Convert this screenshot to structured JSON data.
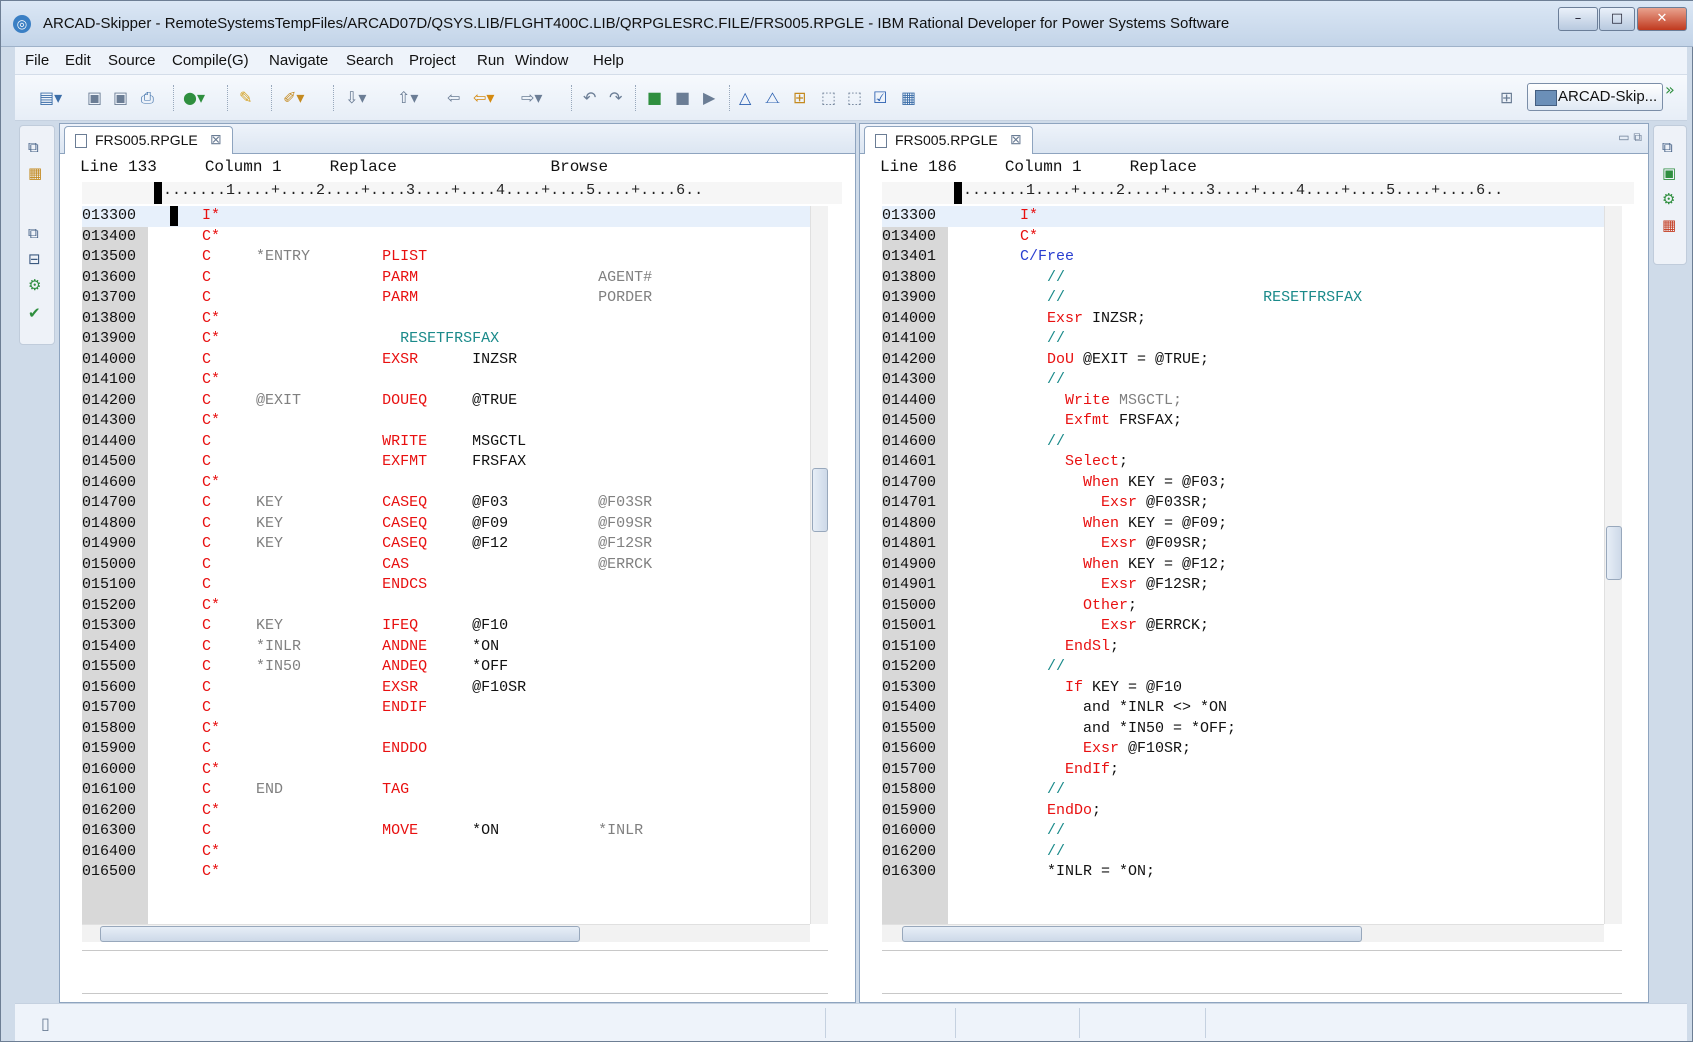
{
  "window": {
    "title": "ARCAD-Skipper - RemoteSystemsTempFiles/ARCAD07D/QSYS.LIB/FLGHT400C.LIB/QRPGLESRC.FILE/FRS005.RPGLE - IBM Rational Developer for Power Systems Software",
    "minimize": "–",
    "maximize": "□",
    "close": "✕"
  },
  "menu": [
    "File",
    "Edit",
    "Source",
    "Compile(G)",
    "Navigate",
    "Search",
    "Project",
    "Run",
    "Window",
    "Help"
  ],
  "perspective": {
    "label": "ARCAD-Skip...",
    "more": "»"
  },
  "left_editor": {
    "tab": "FRS005.RPGLE",
    "status": {
      "line": "Line 133",
      "column": "Column 1",
      "mode": "Replace",
      "browse": "Browse"
    },
    "ruler": "........1....+....2....+....3....+....4....+....5....+....6..",
    "lines": [
      {
        "seq": "013300",
        "spec": "I*",
        "c1": "",
        "op": "",
        "f2": "",
        "res": "",
        "cur": true
      },
      {
        "seq": "013400",
        "spec": "C*",
        "c1": "",
        "op": "",
        "f2": "",
        "res": ""
      },
      {
        "seq": "013500",
        "spec": "C",
        "c1": "*ENTRY",
        "op": "PLIST",
        "f2": "",
        "res": ""
      },
      {
        "seq": "013600",
        "spec": "C",
        "c1": "",
        "op": "PARM",
        "f2": "",
        "res": "AGENT#"
      },
      {
        "seq": "013700",
        "spec": "C",
        "c1": "",
        "op": "PARM",
        "f2": "",
        "res": "PORDER"
      },
      {
        "seq": "013800",
        "spec": "C*",
        "c1": "",
        "op": "",
        "f2": "",
        "res": ""
      },
      {
        "seq": "013900",
        "spec": "C*",
        "c1": "",
        "op": "",
        "f2": "",
        "res": "",
        "comment": "RESETFRSFAX"
      },
      {
        "seq": "014000",
        "spec": "C",
        "c1": "",
        "op": "EXSR",
        "f2": "INZSR",
        "res": ""
      },
      {
        "seq": "014100",
        "spec": "C*",
        "c1": "",
        "op": "",
        "f2": "",
        "res": ""
      },
      {
        "seq": "014200",
        "spec": "C",
        "c1": "@EXIT",
        "op": "DOUEQ",
        "f2": "@TRUE",
        "res": ""
      },
      {
        "seq": "014300",
        "spec": "C*",
        "c1": "",
        "op": "",
        "f2": "",
        "res": ""
      },
      {
        "seq": "014400",
        "spec": "C",
        "c1": "",
        "op": "WRITE",
        "f2": "MSGCTL",
        "res": ""
      },
      {
        "seq": "014500",
        "spec": "C",
        "c1": "",
        "op": "EXFMT",
        "f2": "FRSFAX",
        "res": ""
      },
      {
        "seq": "014600",
        "spec": "C*",
        "c1": "",
        "op": "",
        "f2": "",
        "res": ""
      },
      {
        "seq": "014700",
        "spec": "C",
        "c1": "KEY",
        "op": "CASEQ",
        "f2": "@F03",
        "res": "@F03SR"
      },
      {
        "seq": "014800",
        "spec": "C",
        "c1": "KEY",
        "op": "CASEQ",
        "f2": "@F09",
        "res": "@F09SR"
      },
      {
        "seq": "014900",
        "spec": "C",
        "c1": "KEY",
        "op": "CASEQ",
        "f2": "@F12",
        "res": "@F12SR"
      },
      {
        "seq": "015000",
        "spec": "C",
        "c1": "",
        "op": "CAS",
        "f2": "",
        "res": "@ERRCK"
      },
      {
        "seq": "015100",
        "spec": "C",
        "c1": "",
        "op": "ENDCS",
        "f2": "",
        "res": ""
      },
      {
        "seq": "015200",
        "spec": "C*",
        "c1": "",
        "op": "",
        "f2": "",
        "res": ""
      },
      {
        "seq": "015300",
        "spec": "C",
        "c1": "KEY",
        "op": "IFEQ",
        "f2": "@F10",
        "res": ""
      },
      {
        "seq": "015400",
        "spec": "C",
        "c1": "*INLR",
        "op": "ANDNE",
        "f2": "*ON",
        "res": ""
      },
      {
        "seq": "015500",
        "spec": "C",
        "c1": "*IN50",
        "op": "ANDEQ",
        "f2": "*OFF",
        "res": ""
      },
      {
        "seq": "015600",
        "spec": "C",
        "c1": "",
        "op": "EXSR",
        "f2": "@F10SR",
        "res": ""
      },
      {
        "seq": "015700",
        "spec": "C",
        "c1": "",
        "op": "ENDIF",
        "f2": "",
        "res": ""
      },
      {
        "seq": "015800",
        "spec": "C*",
        "c1": "",
        "op": "",
        "f2": "",
        "res": ""
      },
      {
        "seq": "015900",
        "spec": "C",
        "c1": "",
        "op": "ENDDO",
        "f2": "",
        "res": ""
      },
      {
        "seq": "016000",
        "spec": "C*",
        "c1": "",
        "op": "",
        "f2": "",
        "res": ""
      },
      {
        "seq": "016100",
        "spec": "C",
        "c1": "END",
        "op": "TAG",
        "f2": "",
        "res": ""
      },
      {
        "seq": "016200",
        "spec": "C*",
        "c1": "",
        "op": "",
        "f2": "",
        "res": ""
      },
      {
        "seq": "016300",
        "spec": "C",
        "c1": "",
        "op": "MOVE",
        "f2": "*ON",
        "res": "*INLR"
      },
      {
        "seq": "016400",
        "spec": "C*",
        "c1": "",
        "op": "",
        "f2": "",
        "res": ""
      },
      {
        "seq": "016500",
        "spec": "C*",
        "c1": "",
        "op": "",
        "f2": "",
        "res": ""
      }
    ]
  },
  "right_editor": {
    "tab": "FRS005.RPGLE",
    "status": {
      "line": "Line 186",
      "column": "Column 1",
      "mode": "Replace"
    },
    "ruler": "........1....+....2....+....3....+....4....+....5....+....6..",
    "lines": [
      {
        "seq": "013300",
        "parts": [
          {
            "t": "I*",
            "c": "red"
          }
        ],
        "cur": true
      },
      {
        "seq": "013400",
        "parts": [
          {
            "t": "C*",
            "c": "red"
          }
        ]
      },
      {
        "seq": "013401",
        "parts": [
          {
            "t": "C/Free",
            "c": "blue"
          }
        ]
      },
      {
        "seq": "013800",
        "parts": [
          {
            "t": "   //",
            "c": "teal"
          }
        ]
      },
      {
        "seq": "013900",
        "parts": [
          {
            "t": "   //",
            "c": "teal"
          },
          {
            "t": "                      RESETFRSFAX",
            "c": "teal"
          }
        ]
      },
      {
        "seq": "014000",
        "parts": [
          {
            "t": "   Exsr",
            "c": "red"
          },
          {
            "t": " INZSR;",
            "c": "black"
          }
        ]
      },
      {
        "seq": "014100",
        "parts": [
          {
            "t": "   //",
            "c": "teal"
          }
        ]
      },
      {
        "seq": "014200",
        "parts": [
          {
            "t": "   DoU",
            "c": "red"
          },
          {
            "t": " @EXIT = @TRUE;",
            "c": "black"
          }
        ]
      },
      {
        "seq": "014300",
        "parts": [
          {
            "t": "   //",
            "c": "teal"
          }
        ]
      },
      {
        "seq": "014400",
        "parts": [
          {
            "t": "     Write",
            "c": "red"
          },
          {
            "t": " MSGCTL;",
            "c": "gray"
          }
        ]
      },
      {
        "seq": "014500",
        "parts": [
          {
            "t": "     Exfmt",
            "c": "red"
          },
          {
            "t": " FRSFAX;",
            "c": "black"
          }
        ]
      },
      {
        "seq": "014600",
        "parts": [
          {
            "t": "   //",
            "c": "teal"
          }
        ]
      },
      {
        "seq": "014601",
        "parts": [
          {
            "t": "     Select",
            "c": "red"
          },
          {
            "t": ";",
            "c": "black"
          }
        ]
      },
      {
        "seq": "014700",
        "parts": [
          {
            "t": "       When",
            "c": "red"
          },
          {
            "t": " KEY = @F03;",
            "c": "black"
          }
        ]
      },
      {
        "seq": "014701",
        "parts": [
          {
            "t": "         Exsr",
            "c": "red"
          },
          {
            "t": " @F03SR;",
            "c": "black"
          }
        ]
      },
      {
        "seq": "014800",
        "parts": [
          {
            "t": "       When",
            "c": "red"
          },
          {
            "t": " KEY = @F09;",
            "c": "black"
          }
        ]
      },
      {
        "seq": "014801",
        "parts": [
          {
            "t": "         Exsr",
            "c": "red"
          },
          {
            "t": " @F09SR;",
            "c": "black"
          }
        ]
      },
      {
        "seq": "014900",
        "parts": [
          {
            "t": "       When",
            "c": "red"
          },
          {
            "t": " KEY = @F12;",
            "c": "black"
          }
        ]
      },
      {
        "seq": "014901",
        "parts": [
          {
            "t": "         Exsr",
            "c": "red"
          },
          {
            "t": " @F12SR;",
            "c": "black"
          }
        ]
      },
      {
        "seq": "015000",
        "parts": [
          {
            "t": "       Other",
            "c": "red"
          },
          {
            "t": ";",
            "c": "black"
          }
        ]
      },
      {
        "seq": "015001",
        "parts": [
          {
            "t": "         Exsr",
            "c": "red"
          },
          {
            "t": " @ERRCK;",
            "c": "black"
          }
        ]
      },
      {
        "seq": "015100",
        "parts": [
          {
            "t": "     EndSl",
            "c": "red"
          },
          {
            "t": ";",
            "c": "black"
          }
        ]
      },
      {
        "seq": "015200",
        "parts": [
          {
            "t": "   //",
            "c": "teal"
          }
        ]
      },
      {
        "seq": "015300",
        "parts": [
          {
            "t": "     If",
            "c": "red"
          },
          {
            "t": " KEY = @F10",
            "c": "black"
          }
        ]
      },
      {
        "seq": "015400",
        "parts": [
          {
            "t": "       and *INLR <> *ON",
            "c": "black"
          }
        ]
      },
      {
        "seq": "015500",
        "parts": [
          {
            "t": "       and *IN50 = *OFF;",
            "c": "black"
          }
        ]
      },
      {
        "seq": "015600",
        "parts": [
          {
            "t": "       Exsr",
            "c": "red"
          },
          {
            "t": " @F10SR;",
            "c": "black"
          }
        ]
      },
      {
        "seq": "015700",
        "parts": [
          {
            "t": "     EndIf",
            "c": "red"
          },
          {
            "t": ";",
            "c": "black"
          }
        ]
      },
      {
        "seq": "015800",
        "parts": [
          {
            "t": "   //",
            "c": "teal"
          }
        ]
      },
      {
        "seq": "015900",
        "parts": [
          {
            "t": "   EndDo",
            "c": "red"
          },
          {
            "t": ";",
            "c": "black"
          }
        ]
      },
      {
        "seq": "016000",
        "parts": [
          {
            "t": "   //",
            "c": "teal"
          }
        ]
      },
      {
        "seq": "016200",
        "parts": [
          {
            "t": "   //",
            "c": "teal"
          }
        ]
      },
      {
        "seq": "016300",
        "parts": [
          {
            "t": "   *INLR = *ON;",
            "c": "black"
          }
        ]
      }
    ]
  },
  "colors": {
    "keyword": "#e81010",
    "comment": "#1a8a8a",
    "free": "#2a3fd0",
    "field": "#808080",
    "gutter": "#d8d8d8"
  }
}
